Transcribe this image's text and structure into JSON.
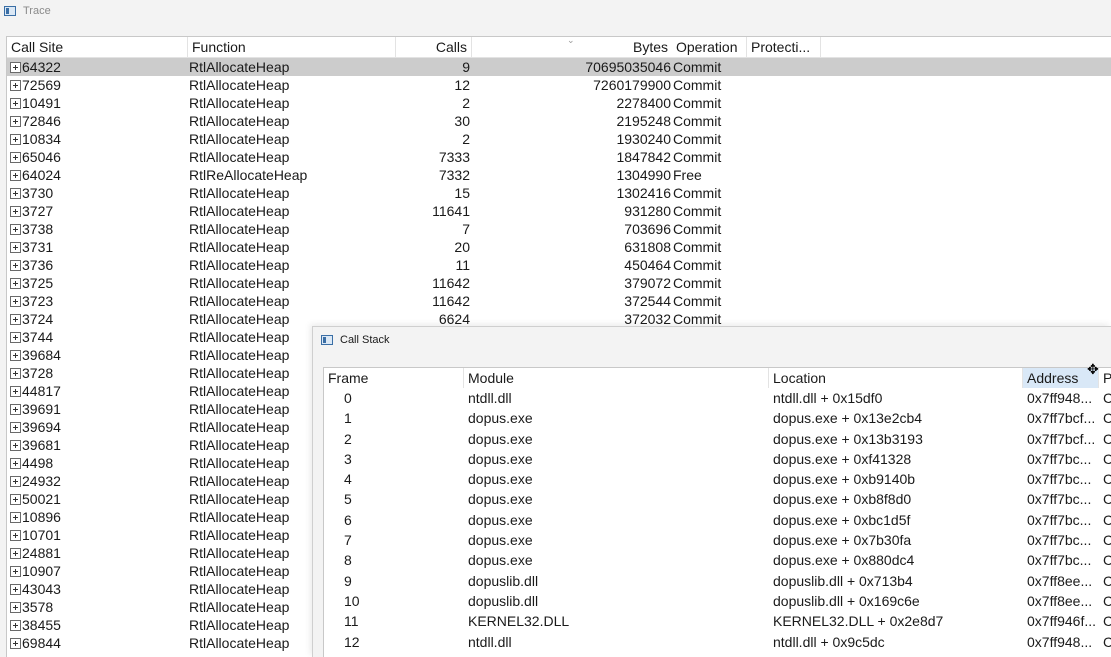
{
  "trace_window": {
    "title": "Trace",
    "columns": [
      "Call Site",
      "Function",
      "Calls",
      "Bytes",
      "Operation",
      "Protecti..."
    ],
    "rows": [
      {
        "site": "64322",
        "function": "RtlAllocateHeap",
        "calls": "9",
        "bytes": "70695035046",
        "operation": "Commit"
      },
      {
        "site": "72569",
        "function": "RtlAllocateHeap",
        "calls": "12",
        "bytes": "7260179900",
        "operation": "Commit"
      },
      {
        "site": "10491",
        "function": "RtlAllocateHeap",
        "calls": "2",
        "bytes": "2278400",
        "operation": "Commit"
      },
      {
        "site": "72846",
        "function": "RtlAllocateHeap",
        "calls": "30",
        "bytes": "2195248",
        "operation": "Commit"
      },
      {
        "site": "10834",
        "function": "RtlAllocateHeap",
        "calls": "2",
        "bytes": "1930240",
        "operation": "Commit"
      },
      {
        "site": "65046",
        "function": "RtlAllocateHeap",
        "calls": "7333",
        "bytes": "1847842",
        "operation": "Commit"
      },
      {
        "site": "64024",
        "function": "RtlReAllocateHeap",
        "calls": "7332",
        "bytes": "1304990",
        "operation": "Free"
      },
      {
        "site": "3730",
        "function": "RtlAllocateHeap",
        "calls": "15",
        "bytes": "1302416",
        "operation": "Commit"
      },
      {
        "site": "3727",
        "function": "RtlAllocateHeap",
        "calls": "11641",
        "bytes": "931280",
        "operation": "Commit"
      },
      {
        "site": "3738",
        "function": "RtlAllocateHeap",
        "calls": "7",
        "bytes": "703696",
        "operation": "Commit"
      },
      {
        "site": "3731",
        "function": "RtlAllocateHeap",
        "calls": "20",
        "bytes": "631808",
        "operation": "Commit"
      },
      {
        "site": "3736",
        "function": "RtlAllocateHeap",
        "calls": "11",
        "bytes": "450464",
        "operation": "Commit"
      },
      {
        "site": "3725",
        "function": "RtlAllocateHeap",
        "calls": "11642",
        "bytes": "379072",
        "operation": "Commit"
      },
      {
        "site": "3723",
        "function": "RtlAllocateHeap",
        "calls": "11642",
        "bytes": "372544",
        "operation": "Commit"
      },
      {
        "site": "3724",
        "function": "RtlAllocateHeap",
        "calls": "6624",
        "bytes": "372032",
        "operation": "Commit"
      },
      {
        "site": "3744",
        "function": "RtlAllocateHeap",
        "calls": "",
        "bytes": "",
        "operation": ""
      },
      {
        "site": "39684",
        "function": "RtlAllocateHeap",
        "calls": "",
        "bytes": "",
        "operation": ""
      },
      {
        "site": "3728",
        "function": "RtlAllocateHeap",
        "calls": "",
        "bytes": "",
        "operation": ""
      },
      {
        "site": "44817",
        "function": "RtlAllocateHeap",
        "calls": "",
        "bytes": "",
        "operation": ""
      },
      {
        "site": "39691",
        "function": "RtlAllocateHeap",
        "calls": "",
        "bytes": "",
        "operation": ""
      },
      {
        "site": "39694",
        "function": "RtlAllocateHeap",
        "calls": "",
        "bytes": "",
        "operation": ""
      },
      {
        "site": "39681",
        "function": "RtlAllocateHeap",
        "calls": "",
        "bytes": "",
        "operation": ""
      },
      {
        "site": "4498",
        "function": "RtlAllocateHeap",
        "calls": "",
        "bytes": "",
        "operation": ""
      },
      {
        "site": "24932",
        "function": "RtlAllocateHeap",
        "calls": "",
        "bytes": "",
        "operation": ""
      },
      {
        "site": "50021",
        "function": "RtlAllocateHeap",
        "calls": "",
        "bytes": "",
        "operation": ""
      },
      {
        "site": "10896",
        "function": "RtlAllocateHeap",
        "calls": "",
        "bytes": "",
        "operation": ""
      },
      {
        "site": "10701",
        "function": "RtlAllocateHeap",
        "calls": "",
        "bytes": "",
        "operation": ""
      },
      {
        "site": "24881",
        "function": "RtlAllocateHeap",
        "calls": "",
        "bytes": "",
        "operation": ""
      },
      {
        "site": "10907",
        "function": "RtlAllocateHeap",
        "calls": "",
        "bytes": "",
        "operation": ""
      },
      {
        "site": "43043",
        "function": "RtlAllocateHeap",
        "calls": "",
        "bytes": "",
        "operation": ""
      },
      {
        "site": "3578",
        "function": "RtlAllocateHeap",
        "calls": "",
        "bytes": "",
        "operation": ""
      },
      {
        "site": "38455",
        "function": "RtlAllocateHeap",
        "calls": "",
        "bytes": "",
        "operation": ""
      },
      {
        "site": "69844",
        "function": "RtlAllocateHeap",
        "calls": "",
        "bytes": "",
        "operation": ""
      }
    ]
  },
  "call_stack_window": {
    "title": "Call Stack",
    "columns": [
      "Frame",
      "Module",
      "Location",
      "Address",
      "P"
    ],
    "frames": [
      {
        "frame": "0",
        "module": "ntdll.dll",
        "location": "ntdll.dll + 0x15df0",
        "address": "0x7ff948...",
        "p": "C"
      },
      {
        "frame": "1",
        "module": "dopus.exe",
        "location": "dopus.exe + 0x13e2cb4",
        "address": "0x7ff7bcf...",
        "p": "C"
      },
      {
        "frame": "2",
        "module": "dopus.exe",
        "location": "dopus.exe + 0x13b3193",
        "address": "0x7ff7bcf...",
        "p": "C"
      },
      {
        "frame": "3",
        "module": "dopus.exe",
        "location": "dopus.exe + 0xf41328",
        "address": "0x7ff7bc...",
        "p": "C"
      },
      {
        "frame": "4",
        "module": "dopus.exe",
        "location": "dopus.exe + 0xb9140b",
        "address": "0x7ff7bc...",
        "p": "C"
      },
      {
        "frame": "5",
        "module": "dopus.exe",
        "location": "dopus.exe + 0xb8f8d0",
        "address": "0x7ff7bc...",
        "p": "C"
      },
      {
        "frame": "6",
        "module": "dopus.exe",
        "location": "dopus.exe + 0xbc1d5f",
        "address": "0x7ff7bc...",
        "p": "C"
      },
      {
        "frame": "7",
        "module": "dopus.exe",
        "location": "dopus.exe + 0x7b30fa",
        "address": "0x7ff7bc...",
        "p": "C"
      },
      {
        "frame": "8",
        "module": "dopus.exe",
        "location": "dopus.exe + 0x880dc4",
        "address": "0x7ff7bc...",
        "p": "C"
      },
      {
        "frame": "9",
        "module": "dopuslib.dll",
        "location": "dopuslib.dll + 0x713b4",
        "address": "0x7ff8ee...",
        "p": "C"
      },
      {
        "frame": "10",
        "module": "dopuslib.dll",
        "location": "dopuslib.dll + 0x169c6e",
        "address": "0x7ff8ee...",
        "p": "C"
      },
      {
        "frame": "11",
        "module": "KERNEL32.DLL",
        "location": "KERNEL32.DLL + 0x2e8d7",
        "address": "0x7ff946f...",
        "p": "C"
      },
      {
        "frame": "12",
        "module": "ntdll.dll",
        "location": "ntdll.dll + 0x9c5dc",
        "address": "0x7ff948...",
        "p": "C"
      }
    ]
  },
  "icons": {
    "window": "window-icon",
    "expand": "plus-box-icon",
    "cursor": "resize-cursor-icon"
  },
  "colors": {
    "selected_row": "#cccccc",
    "active_header": "#d9e8f7"
  }
}
